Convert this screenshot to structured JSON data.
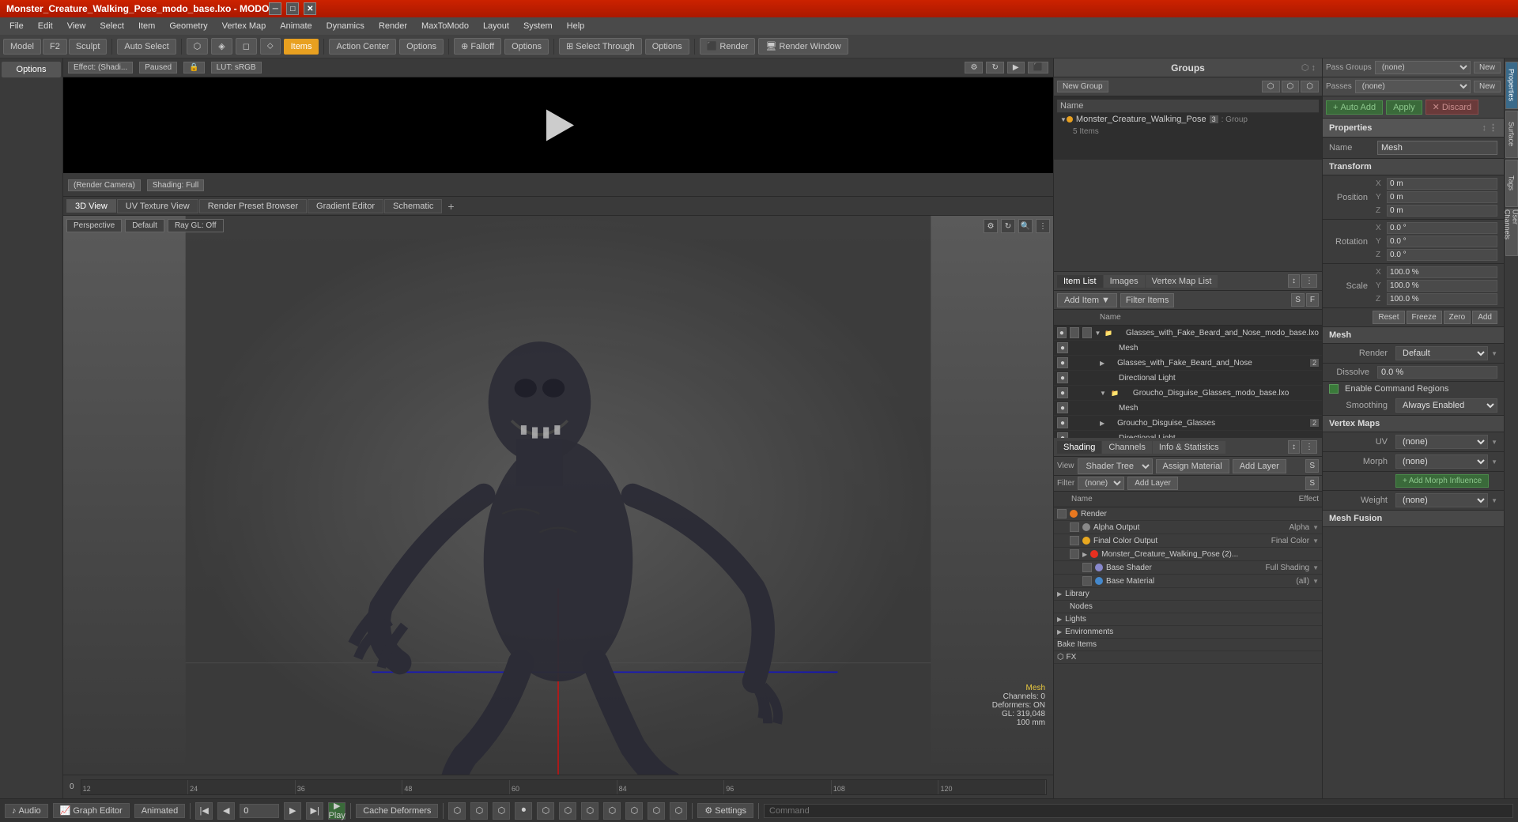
{
  "titlebar": {
    "title": "Monster_Creature_Walking_Pose_modo_base.lxo - MODO",
    "controls": [
      "minimize",
      "maximize",
      "close"
    ]
  },
  "menubar": {
    "items": [
      "File",
      "Edit",
      "View",
      "Select",
      "Item",
      "Geometry",
      "Vertex Map",
      "Animate",
      "Dynamics",
      "Render",
      "MaxToModo",
      "Layout",
      "System",
      "Help"
    ]
  },
  "toolbar": {
    "mode_buttons": [
      "Model",
      "F2",
      "Sculpt"
    ],
    "auto_select": "Auto Select",
    "items": "Items",
    "action_center": "Action Center",
    "options1": "Options",
    "falloff": "Falloff",
    "options2": "Options",
    "select_through": "Select Through",
    "options3": "Options",
    "render": "Render",
    "render_window": "Render Window"
  },
  "groups": {
    "title": "Groups",
    "new_group_btn": "New Group",
    "col_header": "Name",
    "items": [
      {
        "name": "Monster_Creature_Walking_Pose",
        "badge": "3",
        "sub": "Group",
        "children": "5 Items"
      }
    ]
  },
  "preview": {
    "effect": "Effect: (Shadi...",
    "status": "Paused",
    "lut": "LUT: sRGB",
    "render_camera": "(Render Camera)",
    "shading": "Shading: Full"
  },
  "view_tabs": {
    "tabs": [
      "3D View",
      "UV Texture View",
      "Render Preset Browser",
      "Gradient Editor",
      "Schematic"
    ],
    "add": "+"
  },
  "viewport": {
    "perspective": "Perspective",
    "default": "Default",
    "ray_gl": "Ray GL: Off",
    "info": {
      "label": "Mesh",
      "channels": "Channels: 0",
      "deformers": "Deformers: ON",
      "gl": "GL: 319,048",
      "size": "100 mm"
    }
  },
  "item_list": {
    "tabs": [
      "Item List",
      "Images",
      "Vertex Map List"
    ],
    "add_item": "Add Item",
    "filter_items": "Filter Items",
    "col_name": "Name",
    "items": [
      {
        "indent": 1,
        "name": "Glasses_with_Fake_Beard_and_Nose_modo_base.lxo",
        "type": "file",
        "expandable": true
      },
      {
        "indent": 2,
        "name": "Mesh",
        "type": "mesh"
      },
      {
        "indent": 1,
        "name": "Glasses_with_Fake_Beard_and_Nose",
        "badge": "2",
        "type": "group",
        "expandable": true
      },
      {
        "indent": 2,
        "name": "Directional Light",
        "type": "light"
      },
      {
        "indent": 1,
        "name": "Groucho_Disguise_Glasses_modo_base.lxo",
        "type": "file",
        "expandable": true
      },
      {
        "indent": 2,
        "name": "Mesh",
        "type": "mesh"
      },
      {
        "indent": 1,
        "name": "Groucho_Disguise_Glasses",
        "badge": "2",
        "type": "group",
        "expandable": true
      },
      {
        "indent": 2,
        "name": "Directional Light",
        "type": "light"
      }
    ]
  },
  "shader": {
    "tabs": [
      "Shading",
      "Channels",
      "Info & Statistics"
    ],
    "view_label": "View",
    "view_value": "Shader Tree",
    "assign_material": "Assign Material",
    "add_layer": "Add Layer",
    "filter_label": "Filter",
    "filter_value": "(none)",
    "col_name": "Name",
    "col_effect": "Effect",
    "items": [
      {
        "indent": 0,
        "name": "Render",
        "color": "render",
        "type": "render"
      },
      {
        "indent": 1,
        "name": "Alpha Output",
        "color": "alpha",
        "effect": "Alpha"
      },
      {
        "indent": 1,
        "name": "Final Color Output",
        "color": "color",
        "effect": "Final Color"
      },
      {
        "indent": 1,
        "name": "Monster_Creature_Walking_Pose (2)...",
        "color": "monster",
        "expandable": true
      },
      {
        "indent": 2,
        "name": "Base Shader",
        "color": "base-shader",
        "effect": "Full Shading"
      },
      {
        "indent": 2,
        "name": "Base Material",
        "color": "base-material",
        "effect": "(all)"
      },
      {
        "indent": 0,
        "name": "Library",
        "expandable": true
      },
      {
        "indent": 1,
        "name": "Nodes"
      },
      {
        "indent": 0,
        "name": "Lights",
        "expandable": true
      },
      {
        "indent": 0,
        "name": "Environments",
        "expandable": true
      },
      {
        "indent": 0,
        "name": "Bake Items"
      },
      {
        "indent": 0,
        "name": "FX",
        "type": "fx"
      }
    ]
  },
  "properties": {
    "title": "Properties",
    "pass_groups_label": "Pass Groups",
    "passes_label": "Passes",
    "pass_value": "(none)",
    "passes_value": "(none)",
    "new_btn": "New",
    "auto_add": "Auto Add",
    "apply": "Apply",
    "discard": "Discard",
    "section_title": "Properties",
    "name_label": "Name",
    "name_value": "Mesh",
    "transform_section": "Transform",
    "position": {
      "label": "Position",
      "x": "0 m",
      "y": "0 m",
      "z": "0 m"
    },
    "rotation": {
      "label": "Rotation",
      "x": "0.0 °",
      "y": "0.0 °",
      "z": "0.0 °"
    },
    "scale": {
      "label": "Scale",
      "x": "100.0 %",
      "y": "100.0 %",
      "z": "100.0 %"
    },
    "reset_btn": "Reset",
    "freeze_btn": "Freeze",
    "zero_btn": "Zero",
    "add_btn": "Add",
    "mesh_section": "Mesh",
    "render_label": "Render",
    "render_value": "Default",
    "dissolve_label": "Dissolve",
    "dissolve_value": "0.0 %",
    "enable_command": "Enable Command Regions",
    "smoothing_label": "Smoothing",
    "smoothing_value": "Always Enabled",
    "vertex_maps_section": "Vertex Maps",
    "uv_label": "UV",
    "uv_value": "(none)",
    "morph_label": "Morph",
    "morph_value": "(none)",
    "add_morph_influence": "Add Morph Influence",
    "weight_label": "Weight",
    "weight_value": "(none)",
    "mesh_fusion_section": "Mesh Fusion"
  },
  "vtabs": {
    "items": [
      "Properties",
      "Surface",
      "Tags",
      "User Channels"
    ]
  },
  "bottom_bar": {
    "audio_btn": "Audio",
    "graph_editor_btn": "Graph Editor",
    "animated_btn": "Animated",
    "frame_value": "0",
    "play_btn": "Play",
    "cache_deformers": "Cache Deformers",
    "settings_btn": "Settings",
    "command_placeholder": "Command"
  },
  "timeline": {
    "marks": [
      "0",
      "12",
      "24",
      "36",
      "48",
      "60",
      "84",
      "96",
      "108",
      "120"
    ]
  }
}
